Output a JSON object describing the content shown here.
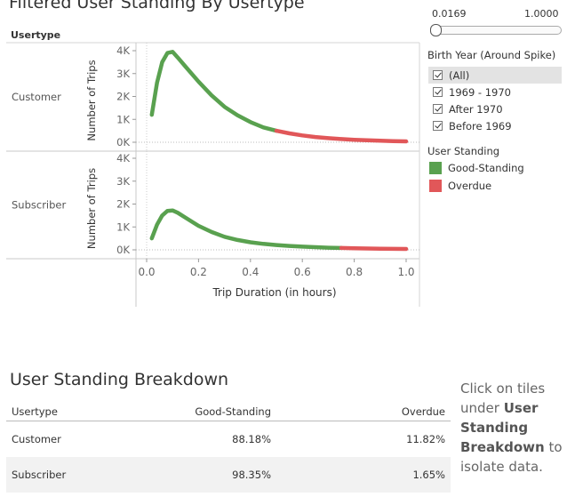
{
  "dashboard": {
    "title": "Filtered User Standing By Usertype",
    "header_usertype": "Usertype"
  },
  "slider": {
    "min_label": "0.0169",
    "max_label": "1.0000"
  },
  "birth_year_filter": {
    "title": "Birth Year (Around Spike)",
    "items": [
      {
        "label": "(All)",
        "checked": true,
        "selected": true
      },
      {
        "label": "1969 - 1970",
        "checked": true
      },
      {
        "label": "After 1970",
        "checked": true
      },
      {
        "label": "Before 1969",
        "checked": true
      }
    ]
  },
  "standing_legend": {
    "title": "User Standing",
    "items": [
      {
        "label": "Good-Standing",
        "color": "#59a14f"
      },
      {
        "label": "Overdue",
        "color": "#e15759"
      }
    ]
  },
  "chart_data": {
    "type": "line",
    "title": "Filtered User Standing By Usertype",
    "xlabel": "Trip Duration (in hours)",
    "ylabel": "Number of Trips",
    "xlim": [
      0.0,
      1.0
    ],
    "ylim": [
      0,
      4000
    ],
    "x_ticks": [
      "0.0",
      "0.2",
      "0.4",
      "0.6",
      "0.8",
      "1.0"
    ],
    "y_ticks": [
      "0K",
      "1K",
      "2K",
      "3K",
      "4K"
    ],
    "rows": [
      {
        "name": "Customer",
        "overdue_threshold": 0.5,
        "points": [
          [
            0.02,
            1200
          ],
          [
            0.04,
            2600
          ],
          [
            0.06,
            3500
          ],
          [
            0.08,
            3900
          ],
          [
            0.1,
            3950
          ],
          [
            0.12,
            3700
          ],
          [
            0.15,
            3300
          ],
          [
            0.2,
            2650
          ],
          [
            0.25,
            2050
          ],
          [
            0.3,
            1550
          ],
          [
            0.35,
            1180
          ],
          [
            0.4,
            880
          ],
          [
            0.45,
            650
          ],
          [
            0.5,
            500
          ],
          [
            0.55,
            390
          ],
          [
            0.6,
            300
          ],
          [
            0.65,
            230
          ],
          [
            0.7,
            180
          ],
          [
            0.75,
            140
          ],
          [
            0.8,
            110
          ],
          [
            0.85,
            85
          ],
          [
            0.9,
            65
          ],
          [
            0.95,
            50
          ],
          [
            1.0,
            40
          ]
        ]
      },
      {
        "name": "Subscriber",
        "overdue_threshold": 0.75,
        "points": [
          [
            0.02,
            500
          ],
          [
            0.04,
            1100
          ],
          [
            0.06,
            1500
          ],
          [
            0.08,
            1700
          ],
          [
            0.1,
            1720
          ],
          [
            0.12,
            1620
          ],
          [
            0.15,
            1400
          ],
          [
            0.2,
            1050
          ],
          [
            0.25,
            780
          ],
          [
            0.3,
            570
          ],
          [
            0.35,
            430
          ],
          [
            0.4,
            330
          ],
          [
            0.45,
            260
          ],
          [
            0.5,
            210
          ],
          [
            0.55,
            170
          ],
          [
            0.6,
            140
          ],
          [
            0.65,
            115
          ],
          [
            0.7,
            95
          ],
          [
            0.75,
            80
          ],
          [
            0.8,
            68
          ],
          [
            0.85,
            58
          ],
          [
            0.9,
            50
          ],
          [
            0.95,
            43
          ],
          [
            1.0,
            37
          ]
        ]
      }
    ],
    "colors": {
      "good": "#59a14f",
      "overdue": "#e15759"
    },
    "grid": true
  },
  "breakdown": {
    "title": "User Standing Breakdown",
    "headers": [
      "Usertype",
      "Good-Standing",
      "Overdue"
    ],
    "rows": [
      {
        "usertype": "Customer",
        "good": "88.18%",
        "overdue": "11.82%"
      },
      {
        "usertype": "Subscriber",
        "good": "98.35%",
        "overdue": "1.65%"
      }
    ]
  },
  "hint": {
    "part1": "Click on tiles under",
    "bold": "User Standing Breakdown",
    "part2": "to isolate data."
  }
}
